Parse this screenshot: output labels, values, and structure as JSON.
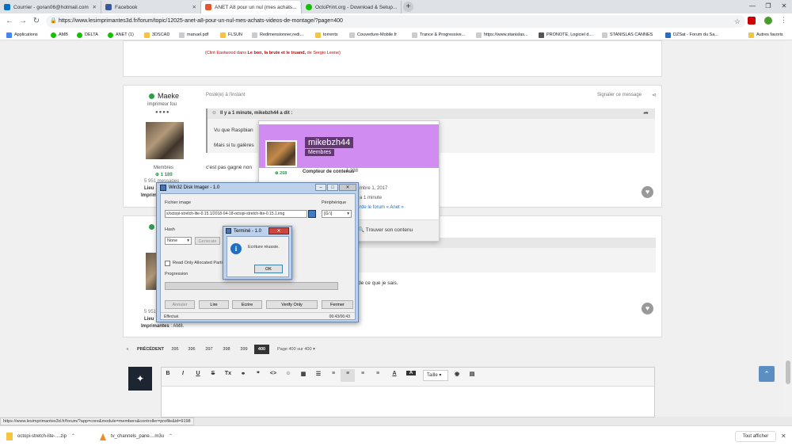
{
  "browser": {
    "tabs": [
      {
        "label": "Courrier - goran06@hotmail.com"
      },
      {
        "label": "Facebook"
      },
      {
        "label": "ANET A8 pour un nul (mes achats..."
      },
      {
        "label": "OctoPrint.org - Download & Setup..."
      }
    ],
    "url": "https://www.lesimprimantes3d.fr/forum/topic/12025-anet-a8-pour-un-nul-mes-achats-videos-de-montage/?page=400",
    "bookmarks": [
      "Applications",
      "AMB",
      "DELTA",
      "ANET (1)",
      "3DSCAD",
      "manuel.pdf",
      "FLSUN",
      "Redimensionner,redi...",
      "torrents",
      "Couverture-Mobile.fr",
      "Trance & Progressive...",
      "https://www.stanislas...",
      "PRONOTE, Logiciel d...",
      "STANISLAS CANNES",
      "DZSat - Forum du Sa...",
      "Autres favoris"
    ]
  },
  "forum": {
    "top_quote": {
      "pre": "(Clint Eastwood dans ",
      "t1": "Le bon, la brute et le truand,",
      "mid": " de Sergio Leone)"
    },
    "post1": {
      "author": "Maeke",
      "rank": "Imprimeur fou",
      "group": "Membres",
      "rep": "1 189",
      "messages": "5 951 messages",
      "location_label": "Lieu",
      "printers_label": "Imprimantes",
      "posted": "Posté(e) à l'instant",
      "report": "Signaler ce message",
      "quote_header": "Il y a 1 minute, mikebzh44 a dit :",
      "quote_line1": "Vu que Raspbian",
      "quote_line2": "Mais si tu galères",
      "body": "c'est pas gagné non"
    },
    "post2": {
      "messages": "5 951",
      "location_label": "Lieu",
      "printers_label": "Imprimantes",
      "printers_value": ": AM8.",
      "body_end": "de ce que je sais."
    },
    "hovercard": {
      "name": "mikebzh44",
      "group": "Membres",
      "rep": "268",
      "rows": [
        {
          "label": "Compteur de contenus",
          "value": "1 238"
        },
        {
          "label": "",
          "value": "mbre 1, 2017"
        },
        {
          "label": "",
          "value": "a 1 minute"
        },
        {
          "label": "",
          "value": "rde le forum « Anet »"
        }
      ],
      "find_content": "Trouver son contenu"
    },
    "pagination": {
      "prev": "PRÉCÉDENT",
      "pages": [
        "395",
        "396",
        "397",
        "398",
        "399",
        "400"
      ],
      "current": "400",
      "summary": "Page 400 sur 400"
    },
    "editor": {
      "size_label": "Taille"
    }
  },
  "disk_imager": {
    "title": "Win32 Disk Imager - 1.0",
    "image_file_label": "Fichier image",
    "image_file_value": "s/octopi-stretch-lite-0.15.1/2018-04-18-octopi-stretch-lite-0.15.1.img",
    "device_label": "Périphérique",
    "device_value": "[G:\\]",
    "hash_label": "Hash",
    "hash_value": "None",
    "generate": "Generate",
    "read_only": "Read Only Allocated Parti",
    "progress_label": "Progression",
    "buttons": [
      "Annuler",
      "Lire",
      "Ecrire",
      "Verify Only",
      "Fermer"
    ],
    "status": "Effectué.",
    "time": "06:43/06:43"
  },
  "done_dialog": {
    "title": "Terminé - 1.0",
    "message": "Ecriture réussie.",
    "ok": "OK"
  },
  "status_url": "https://www.lesimprimantes3d.fr/forum/?app=core&module=members&controller=profile&id=9198",
  "downloads": {
    "items": [
      "octopi-stretch-lite-....zip",
      "tv_channels_pane....m3u"
    ],
    "show_all": "Tout afficher"
  }
}
